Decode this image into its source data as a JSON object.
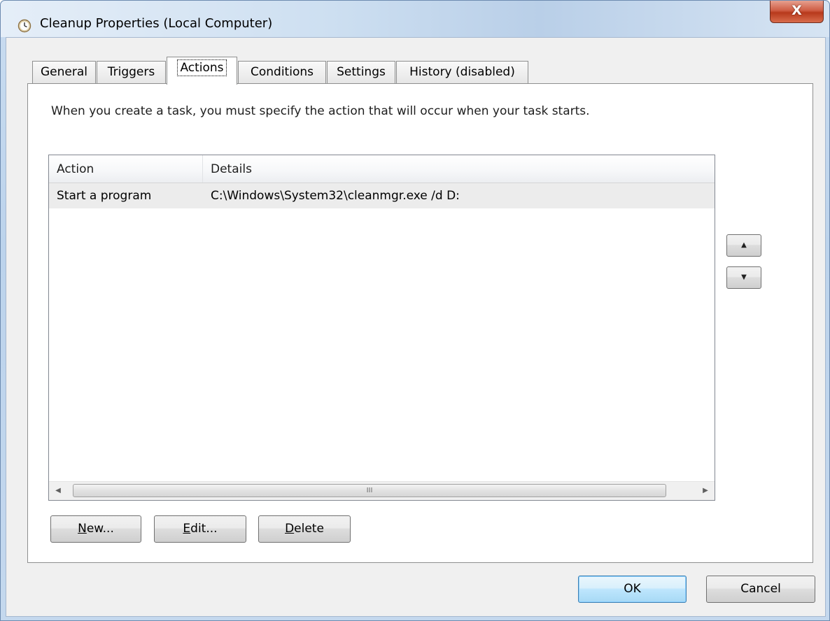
{
  "window": {
    "title": "Cleanup Properties (Local Computer)",
    "close_label": "X",
    "title_icon": "clock-icon"
  },
  "tabs": [
    {
      "label": "General",
      "active": false
    },
    {
      "label": "Triggers",
      "active": false
    },
    {
      "label": "Actions",
      "active": true
    },
    {
      "label": "Conditions",
      "active": false
    },
    {
      "label": "Settings",
      "active": false
    },
    {
      "label": "History (disabled)",
      "active": false
    }
  ],
  "actions_tab": {
    "description": "When you create a task, you must specify the action that will occur when your task starts.",
    "columns": [
      "Action",
      "Details"
    ],
    "rows": [
      {
        "action": "Start a program",
        "details": "C:\\Windows\\System32\\cleanmgr.exe /d D:"
      }
    ],
    "move_up_icon": "triangle-up-icon",
    "move_down_icon": "triangle-down-icon",
    "scroll_left_icon": "triangle-left-icon",
    "scroll_right_icon": "triangle-right-icon",
    "scroll_grip": "III",
    "buttons": {
      "new": {
        "mnemonic": "N",
        "rest": "ew..."
      },
      "edit": {
        "mnemonic": "E",
        "rest": "dit..."
      },
      "delete": {
        "mnemonic": "D",
        "rest": "elete"
      }
    }
  },
  "footer": {
    "ok": "OK",
    "cancel": "Cancel"
  }
}
